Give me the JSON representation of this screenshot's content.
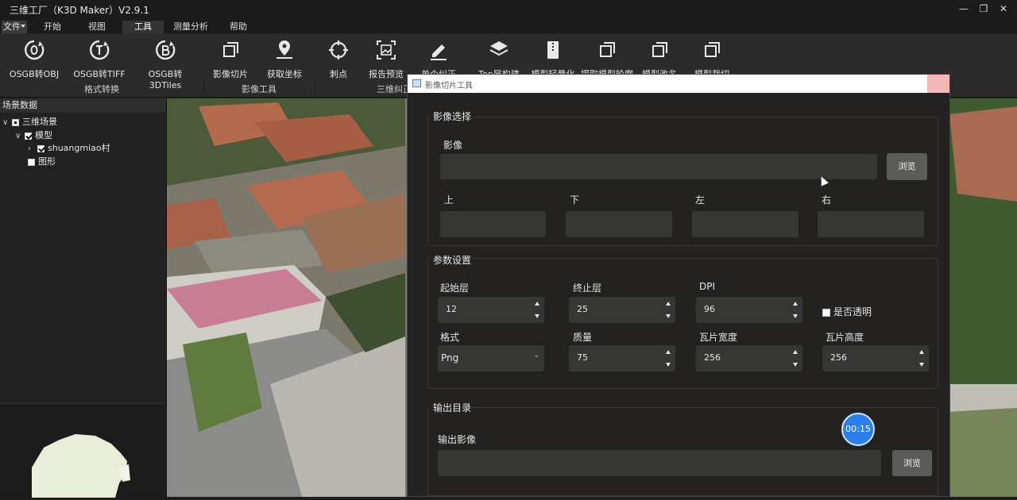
{
  "window": {
    "title": "三维工厂（K3D Maker）V2.9.1"
  },
  "menu": {
    "file": "文件",
    "tabs": [
      "开始",
      "视图",
      "工具",
      "测量分析",
      "帮助"
    ],
    "active_tab": "工具"
  },
  "ribbon": {
    "tools": [
      {
        "label": "OSGB转OBJ",
        "icon": "osgb-to-obj-icon"
      },
      {
        "label": "OSGB转TIFF",
        "icon": "osgb-to-tiff-icon"
      },
      {
        "label": "OSGB转3DTiles",
        "icon": "osgb-to-3dtiles-icon"
      },
      {
        "label": "影像切片",
        "icon": "image-tile-icon"
      },
      {
        "label": "获取坐标",
        "icon": "location-pin-icon"
      },
      {
        "label": "刺点",
        "icon": "crosshair-icon"
      },
      {
        "label": "报告预览",
        "icon": "report-preview-icon"
      },
      {
        "label": "单个纠正",
        "icon": "pencil-icon"
      },
      {
        "label": "Top层构建",
        "icon": "layers-icon"
      },
      {
        "label": "模型轻量化",
        "icon": "archive-icon"
      },
      {
        "label": "提取模型轮廓",
        "icon": "copy-icon"
      },
      {
        "label": "模型改名",
        "icon": "copy-icon"
      },
      {
        "label": "模型裁切",
        "icon": "copy-icon"
      }
    ],
    "groups": [
      "格式转换",
      "影像工具",
      "三维纠正"
    ]
  },
  "left_panel": {
    "title": "场景数据",
    "tree": {
      "root": "三维场景",
      "model": "模型",
      "village": "shuangmiao村",
      "graphics": "图形"
    }
  },
  "dialog": {
    "title": "影像切片工具",
    "image_section": {
      "title": "影像选择",
      "image_label": "影像",
      "image_value": "",
      "browse": "浏览",
      "bounds_labels": {
        "top": "上",
        "bottom": "下",
        "left": "左",
        "right": "右"
      }
    },
    "params_section": {
      "title": "参数设置",
      "start_level_label": "起始层",
      "start_level": "12",
      "end_level_label": "终止层",
      "end_level": "25",
      "dpi_label": "DPI",
      "dpi": "96",
      "transparent_label": "是否透明",
      "transparent": false,
      "format_label": "格式",
      "format": "Png",
      "quality_label": "质量",
      "quality": "75",
      "tile_width_label": "瓦片宽度",
      "tile_width": "256",
      "tile_height_label": "瓦片高度",
      "tile_height": "256"
    },
    "output_section": {
      "title": "输出目录",
      "output_label": "输出影像",
      "output_value": "",
      "browse": "浏览"
    }
  },
  "timer": "00:15",
  "colors": {
    "accent": "#2d7ee6",
    "dialog_bg": "#232220",
    "field_bg": "#363634",
    "button_bg": "#5b5b59"
  }
}
